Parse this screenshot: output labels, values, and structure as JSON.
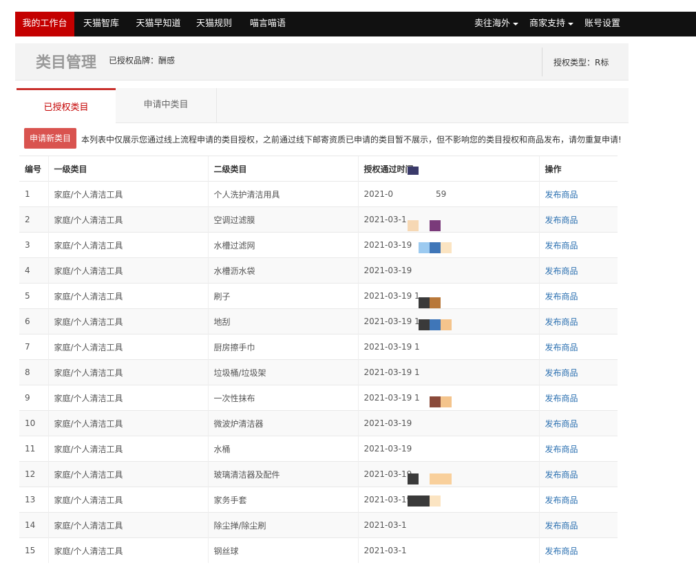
{
  "topnav": {
    "left_items": [
      "我的工作台",
      "天猫智库",
      "天猫早知道",
      "天猫规则",
      "喵言喵语"
    ],
    "right_items": [
      "卖往海外",
      "商家支持",
      "账号设置"
    ]
  },
  "header": {
    "title": "类目管理",
    "brand_label": "已授权品牌：",
    "brand_value": "酬感",
    "auth_type_label": "授权类型：",
    "auth_type_value": "R标"
  },
  "tabs": [
    "已授权类目",
    "申请中类目"
  ],
  "notice": {
    "apply_button": "申请新类目",
    "text": "本列表中仅展示您通过线上流程申请的类目授权，之前通过线下邮寄资质已申请的类目暂不展示，但不影响您的类目授权和商品发布，请勿重复申请!"
  },
  "table": {
    "headers": [
      "编号",
      "一级类目",
      "二级类目",
      "授权通过时间",
      "操作"
    ],
    "rows": [
      {
        "no": "1",
        "cat1": "家庭/个人清洁工具",
        "cat2": "个人洗护清洁用具",
        "time": "2021-0",
        "tail": "59",
        "action": "发布商品"
      },
      {
        "no": "2",
        "cat1": "家庭/个人清洁工具",
        "cat2": "空调过滤膜",
        "time": "2021-03-1",
        "tail": "",
        "action": "发布商品"
      },
      {
        "no": "3",
        "cat1": "家庭/个人清洁工具",
        "cat2": "水槽过滤网",
        "time": "2021-03-19",
        "tail": "",
        "action": "发布商品"
      },
      {
        "no": "4",
        "cat1": "家庭/个人清洁工具",
        "cat2": "水槽沥水袋",
        "time": "2021-03-19",
        "tail": "",
        "action": "发布商品"
      },
      {
        "no": "5",
        "cat1": "家庭/个人清洁工具",
        "cat2": "刷子",
        "time": "2021-03-19 1",
        "tail": "",
        "action": "发布商品"
      },
      {
        "no": "6",
        "cat1": "家庭/个人清洁工具",
        "cat2": "地刮",
        "time": "2021-03-19 1",
        "tail": "",
        "action": "发布商品"
      },
      {
        "no": "7",
        "cat1": "家庭/个人清洁工具",
        "cat2": "厨房擦手巾",
        "time": "2021-03-19 1",
        "tail": "",
        "action": "发布商品"
      },
      {
        "no": "8",
        "cat1": "家庭/个人清洁工具",
        "cat2": "垃圾桶/垃圾架",
        "time": "2021-03-19 1",
        "tail": "",
        "action": "发布商品"
      },
      {
        "no": "9",
        "cat1": "家庭/个人清洁工具",
        "cat2": "一次性抹布",
        "time": "2021-03-19 1",
        "tail": "",
        "action": "发布商品"
      },
      {
        "no": "10",
        "cat1": "家庭/个人清洁工具",
        "cat2": "微波炉清洁器",
        "time": "2021-03-19",
        "tail": "",
        "action": "发布商品"
      },
      {
        "no": "11",
        "cat1": "家庭/个人清洁工具",
        "cat2": "水桶",
        "time": "2021-03-19",
        "tail": "",
        "action": "发布商品"
      },
      {
        "no": "12",
        "cat1": "家庭/个人清洁工具",
        "cat2": "玻璃清洁器及配件",
        "time": "2021-03-19",
        "tail": "",
        "action": "发布商品"
      },
      {
        "no": "13",
        "cat1": "家庭/个人清洁工具",
        "cat2": "家务手套",
        "time": "2021-03-19",
        "tail": "",
        "action": "发布商品"
      },
      {
        "no": "14",
        "cat1": "家庭/个人清洁工具",
        "cat2": "除尘掸/除尘刷",
        "time": "2021-03-1",
        "tail": "",
        "action": "发布商品"
      },
      {
        "no": "15",
        "cat1": "家庭/个人清洁工具",
        "cat2": "钢丝球",
        "time": "2021-03-1",
        "tail": "",
        "action": "发布商品"
      }
    ]
  },
  "colors": {
    "nav_bg": "#111111",
    "nav_active": "#c40000",
    "apply_button": "#d9534f",
    "link": "#2a6fb0",
    "mosaic": [
      "#3a3a6a",
      "#f6d8b4",
      "#7a3a7a",
      "#9ccaf0",
      "#3f76b8",
      "#fbe4c2",
      "#3a3a3a",
      "#b8783a",
      "#8a4a3a",
      "#f4c48c"
    ]
  }
}
